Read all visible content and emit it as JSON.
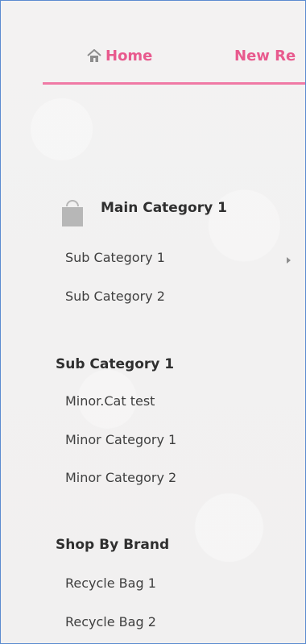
{
  "nav": {
    "home": "Home",
    "new": "New Re"
  },
  "main_category": "Main Category 1",
  "sub_categories": [
    "Sub Category 1",
    "Sub Category 2"
  ],
  "sub_category_section": "Sub Category 1",
  "minor_categories": [
    "Minor.Cat test",
    "Minor Category 1",
    "Minor Category 2"
  ],
  "brand_section": "Shop By Brand",
  "brands": [
    "Recycle Bag 1",
    "Recycle Bag 2"
  ]
}
